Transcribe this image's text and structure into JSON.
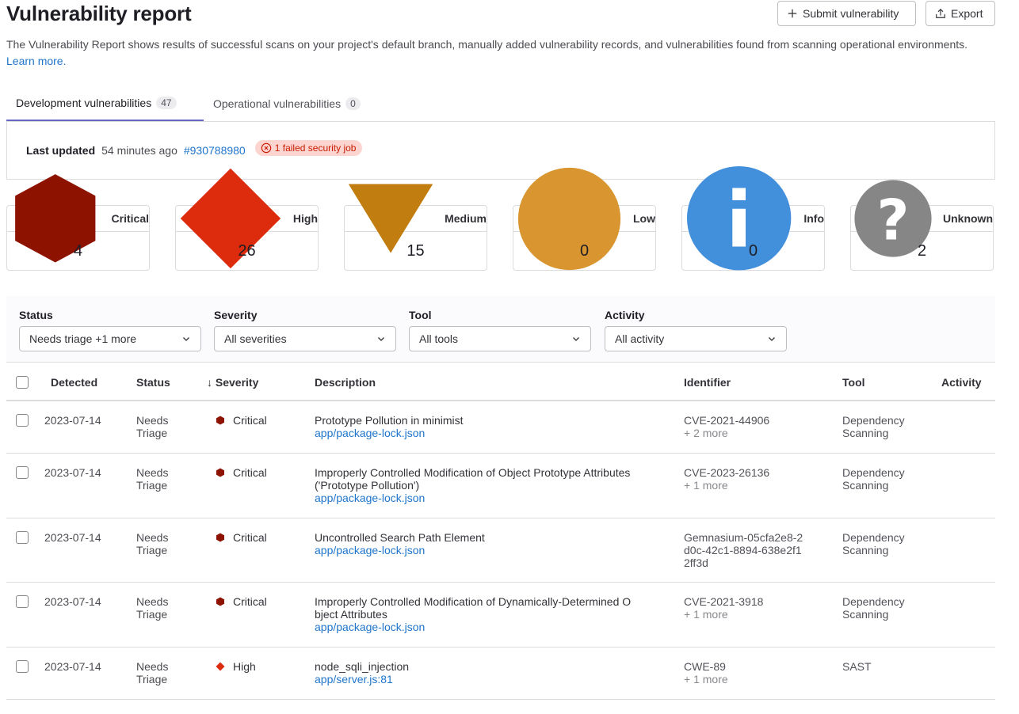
{
  "header": {
    "title": "Vulnerability report",
    "submit_label": "Submit vulnerability",
    "export_label": "Export"
  },
  "intro": {
    "text": "The Vulnerability Report shows results of successful scans on your project's default branch, manually added vulnerability records, and vulnerabilities found from scanning operational environments.",
    "link": "Learn more."
  },
  "tabs": [
    {
      "label": "Development vulnerabilities",
      "count": "47"
    },
    {
      "label": "Operational vulnerabilities",
      "count": "0"
    }
  ],
  "updated": {
    "label": "Last updated",
    "time": "54 minutes ago",
    "pipeline": "#930788980",
    "failed_job": "1 failed security job"
  },
  "severity_cards": [
    {
      "label": "Critical",
      "count": "4",
      "icon": "critical-severity-icon",
      "color": "#8d1300"
    },
    {
      "label": "High",
      "count": "26",
      "icon": "high-severity-icon",
      "color": "#dd2b0e"
    },
    {
      "label": "Medium",
      "count": "15",
      "icon": "medium-severity-icon",
      "color": "#c17d10"
    },
    {
      "label": "Low",
      "count": "0",
      "icon": "low-severity-icon",
      "color": "#d99530"
    },
    {
      "label": "Info",
      "count": "0",
      "icon": "info-severity-icon",
      "color": "#428fdc"
    },
    {
      "label": "Unknown",
      "count": "2",
      "icon": "unknown-severity-icon",
      "color": "#868686"
    }
  ],
  "filters": [
    {
      "label": "Status",
      "value": "Needs triage +1 more"
    },
    {
      "label": "Severity",
      "value": "All severities"
    },
    {
      "label": "Tool",
      "value": "All tools"
    },
    {
      "label": "Activity",
      "value": "All activity"
    }
  ],
  "table": {
    "headers": {
      "detected": "Detected",
      "status": "Status",
      "severity": "Severity",
      "sort_arrow": "↓",
      "description": "Description",
      "identifier": "Identifier",
      "tool": "Tool",
      "activity": "Activity"
    },
    "rows": [
      {
        "detected": "2023-07-14",
        "status": [
          "Needs",
          "Triage"
        ],
        "severity": "Critical",
        "desc": [
          "Prototype Pollution in minimist"
        ],
        "file": "app/package-lock.json",
        "identifier": [
          "CVE-2021-44906"
        ],
        "more": "+ 2 more",
        "tool": [
          "Dependency",
          "Scanning"
        ]
      },
      {
        "detected": "2023-07-14",
        "status": [
          "Needs",
          "Triage"
        ],
        "severity": "Critical",
        "desc": [
          "Improperly Controlled Modification of Object Prototype Attributes",
          "('Prototype Pollution')"
        ],
        "file": "app/package-lock.json",
        "identifier": [
          "CVE-2023-26136"
        ],
        "more": "+ 1 more",
        "tool": [
          "Dependency",
          "Scanning"
        ]
      },
      {
        "detected": "2023-07-14",
        "status": [
          "Needs",
          "Triage"
        ],
        "severity": "Critical",
        "desc": [
          "Uncontrolled Search Path Element"
        ],
        "file": "app/package-lock.json",
        "identifier": [
          "Gemnasium-05cfa2e8-2",
          "d0c-42c1-8894-638e2f1",
          "2ff3d"
        ],
        "more": "",
        "tool": [
          "Dependency",
          "Scanning"
        ]
      },
      {
        "detected": "2023-07-14",
        "status": [
          "Needs",
          "Triage"
        ],
        "severity": "Critical",
        "desc": [
          "Improperly Controlled Modification of Dynamically-Determined O",
          "bject Attributes"
        ],
        "file": "app/package-lock.json",
        "identifier": [
          "CVE-2021-3918"
        ],
        "more": "+ 1 more",
        "tool": [
          "Dependency",
          "Scanning"
        ]
      },
      {
        "detected": "2023-07-14",
        "status": [
          "Needs",
          "Triage"
        ],
        "severity": "High",
        "desc": [
          "node_sqli_injection"
        ],
        "file": "app/server.js:81",
        "identifier": [
          "CWE-89"
        ],
        "more": "+ 1 more",
        "tool": [
          "SAST"
        ]
      }
    ]
  }
}
